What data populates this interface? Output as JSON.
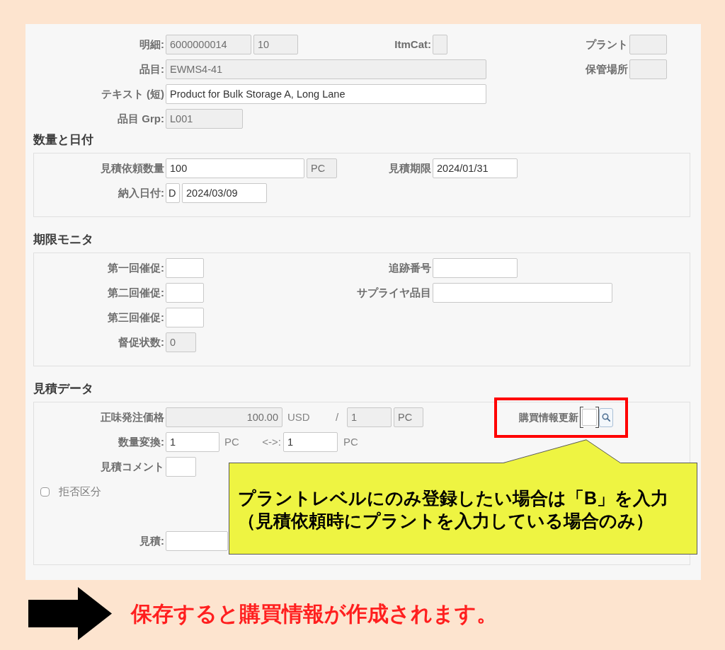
{
  "header": {
    "main": [
      [
        {
          "label": "明細:",
          "parts": [
            {
              "kind": "input",
              "value": "6000000014",
              "readonly": true
            },
            {
              "kind": "input",
              "value": "10",
              "readonly": true
            }
          ]
        },
        {
          "label": "ItmCat:",
          "parts": [
            {
              "kind": "input",
              "readonly": true
            }
          ]
        }
      ],
      [
        {
          "label": "品目:",
          "parts": [
            {
              "kind": "input",
              "value": "EWMS4-41",
              "readonly": true
            }
          ]
        }
      ],
      [
        {
          "label": "テキスト (短)",
          "parts": [
            {
              "kind": "input",
              "value": "Product for Bulk Storage A, Long Lane",
              "readonly": false
            }
          ]
        }
      ],
      [
        {
          "label": "品目 Grp:",
          "parts": [
            {
              "kind": "input",
              "value": "L001",
              "readonly": true
            }
          ]
        }
      ]
    ],
    "side": [
      {
        "label": "プラント",
        "parts": [
          {
            "kind": "input",
            "readonly": true
          }
        ]
      },
      {
        "label": "保管場所",
        "parts": [
          {
            "kind": "input",
            "readonly": true
          }
        ]
      }
    ]
  },
  "sections": [
    {
      "title": "数量と日付",
      "rows": [
        [
          {
            "label": "見積依頼数量",
            "parts": [
              {
                "kind": "input",
                "value": "100",
                "readonly": false
              },
              {
                "kind": "input",
                "value": "PC",
                "readonly": true
              }
            ]
          },
          {
            "label": "見積期限",
            "parts": [
              {
                "kind": "input",
                "value": "2024/01/31",
                "readonly": false
              }
            ]
          }
        ],
        [
          {
            "label": "納入日付:",
            "parts": [
              {
                "kind": "input",
                "value": "D",
                "readonly": false
              },
              {
                "kind": "input",
                "value": "2024/03/09",
                "readonly": false
              }
            ]
          }
        ]
      ]
    },
    {
      "title": "期限モニタ",
      "rows": [
        [
          {
            "label": "第一回催促:",
            "parts": [
              {
                "kind": "input",
                "readonly": false
              }
            ]
          },
          {
            "label": "追跡番号",
            "parts": [
              {
                "kind": "input",
                "readonly": false
              }
            ]
          }
        ],
        [
          {
            "label": "第二回催促:",
            "parts": [
              {
                "kind": "input",
                "readonly": false
              }
            ]
          },
          {
            "label": "サプライヤ品目",
            "parts": [
              {
                "kind": "input",
                "readonly": false
              }
            ]
          }
        ],
        [
          {
            "label": "第三回催促:",
            "parts": [
              {
                "kind": "input",
                "readonly": false
              }
            ]
          }
        ],
        [
          {
            "label": "督促状数:",
            "parts": [
              {
                "kind": "input",
                "value": "0",
                "readonly": true
              }
            ]
          }
        ]
      ]
    },
    {
      "title": "見積データ",
      "rows": [
        [
          {
            "kind": "field",
            "label": "正味発注価格",
            "highlighted": false,
            "parts": [
              {
                "kind": "input",
                "value": "100.00",
                "readonly": true
              },
              {
                "kind": "text",
                "text": "USD"
              },
              {
                "kind": "text",
                "text": "/"
              },
              {
                "kind": "input",
                "value": "1",
                "readonly": true
              },
              {
                "kind": "input",
                "value": "PC",
                "readonly": true
              }
            ]
          },
          {
            "kind": "field",
            "label": "購買情報更新",
            "highlighted": true,
            "parts": [
              {
                "kind": "input",
                "readonly": false,
                "focused": true
              },
              {
                "kind": "search_button",
                "focused": false
              }
            ]
          }
        ],
        [
          {
            "kind": "field",
            "label": "数量変換:",
            "highlighted": false,
            "parts": [
              {
                "kind": "input",
                "value": "1",
                "readonly": false
              },
              {
                "kind": "text",
                "text": "PC"
              },
              {
                "kind": "text",
                "text": "<->:"
              },
              {
                "kind": "input",
                "value": "1",
                "readonly": false
              },
              {
                "kind": "text",
                "text": "PC"
              }
            ]
          }
        ],
        [
          {
            "kind": "field",
            "label": "見積コメント",
            "highlighted": false,
            "parts": [
              {
                "kind": "input",
                "readonly": false
              }
            ]
          }
        ],
        [
          {
            "kind": "checkbox",
            "label": "拒否区分",
            "checked": false,
            "highlighted": false
          }
        ],
        [
          {
            "kind": "field",
            "label": "見積:",
            "highlighted": false,
            "parts": [
              {
                "kind": "input",
                "readonly": false
              }
            ]
          }
        ]
      ]
    }
  ],
  "callout": {
    "lines": [
      "プラントレベルにのみ登録したい場合は「B」を入力",
      "（見積依頼時にプラントを入力している場合のみ）"
    ]
  },
  "footer": {
    "message": "保存すると購買情報が作成されます。"
  }
}
